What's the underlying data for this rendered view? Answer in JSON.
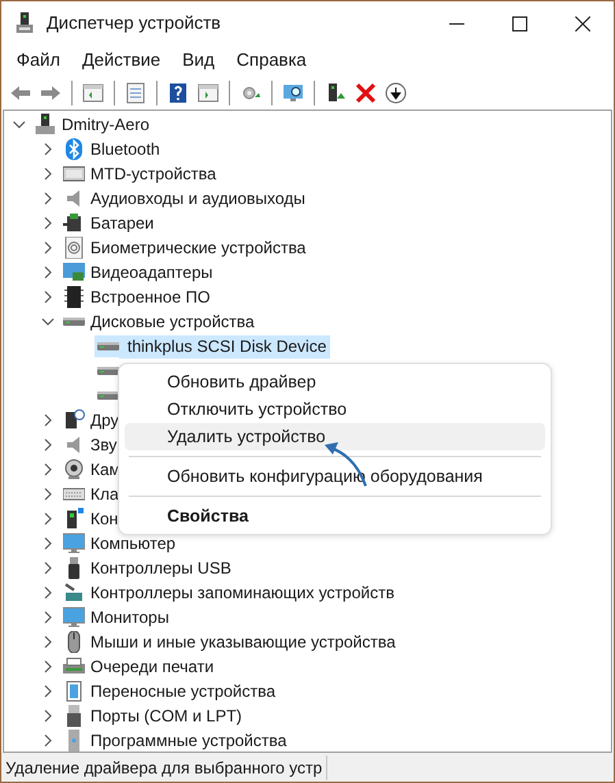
{
  "window": {
    "title": "Диспетчер устройств"
  },
  "menu_bar": [
    "Файл",
    "Действие",
    "Вид",
    "Справка"
  ],
  "tree": {
    "label": "Dmitry-Aero",
    "expanded": true,
    "selected": false,
    "children": [
      {
        "label": "Bluetooth",
        "expanded": false,
        "selected": false
      },
      {
        "label": "MTD-устройства",
        "expanded": false,
        "selected": false
      },
      {
        "label": "Аудиовходы и аудиовыходы",
        "expanded": false,
        "selected": false
      },
      {
        "label": "Батареи",
        "expanded": false,
        "selected": false
      },
      {
        "label": "Биометрические устройства",
        "expanded": false,
        "selected": false
      },
      {
        "label": "Видеоадаптеры",
        "expanded": false,
        "selected": false
      },
      {
        "label": "Встроенное ПО",
        "expanded": false,
        "selected": false
      },
      {
        "label": "Дисковые устройства",
        "expanded": true,
        "selected": false,
        "children": [
          {
            "label": "thinkplus SCSI Disk Device",
            "selected": true
          },
          {
            "selected": false
          },
          {
            "selected": false
          }
        ]
      },
      {
        "label": "Дру",
        "expanded": false,
        "selected": false
      },
      {
        "label": "Зву",
        "expanded": false,
        "selected": false
      },
      {
        "label": "Кам",
        "expanded": false,
        "selected": false
      },
      {
        "label": "Кла",
        "expanded": false,
        "selected": false
      },
      {
        "label": "Кон",
        "expanded": false,
        "selected": false
      },
      {
        "label": "Компьютер",
        "expanded": false,
        "selected": false
      },
      {
        "label": "Контроллеры USB",
        "expanded": false,
        "selected": false
      },
      {
        "label": "Контроллеры запоминающих устройств",
        "expanded": false,
        "selected": false
      },
      {
        "label": "Мониторы",
        "expanded": false,
        "selected": false
      },
      {
        "label": "Мыши и иные указывающие устройства",
        "expanded": false,
        "selected": false
      },
      {
        "label": "Очереди печати",
        "expanded": false,
        "selected": false
      },
      {
        "label": "Переносные устройства",
        "expanded": false,
        "selected": false
      },
      {
        "label": "Порты (COM и LPT)",
        "expanded": false,
        "selected": false
      },
      {
        "label": "Программные устройства",
        "expanded": false,
        "selected": false
      }
    ]
  },
  "context_menu": [
    {
      "kind": "item",
      "label": "Обновить драйвер",
      "selected": false
    },
    {
      "kind": "item",
      "label": "Отключить устройство",
      "selected": false
    },
    {
      "kind": "item",
      "label": "Удалить устройство",
      "selected": true
    },
    {
      "kind": "separator"
    },
    {
      "kind": "item",
      "label": "Обновить конфигурацию оборудования",
      "selected": false
    },
    {
      "kind": "separator"
    },
    {
      "kind": "default",
      "label": "Свойства",
      "selected": false
    }
  ],
  "status_bar": "Удаление драйвера для выбранного устр"
}
